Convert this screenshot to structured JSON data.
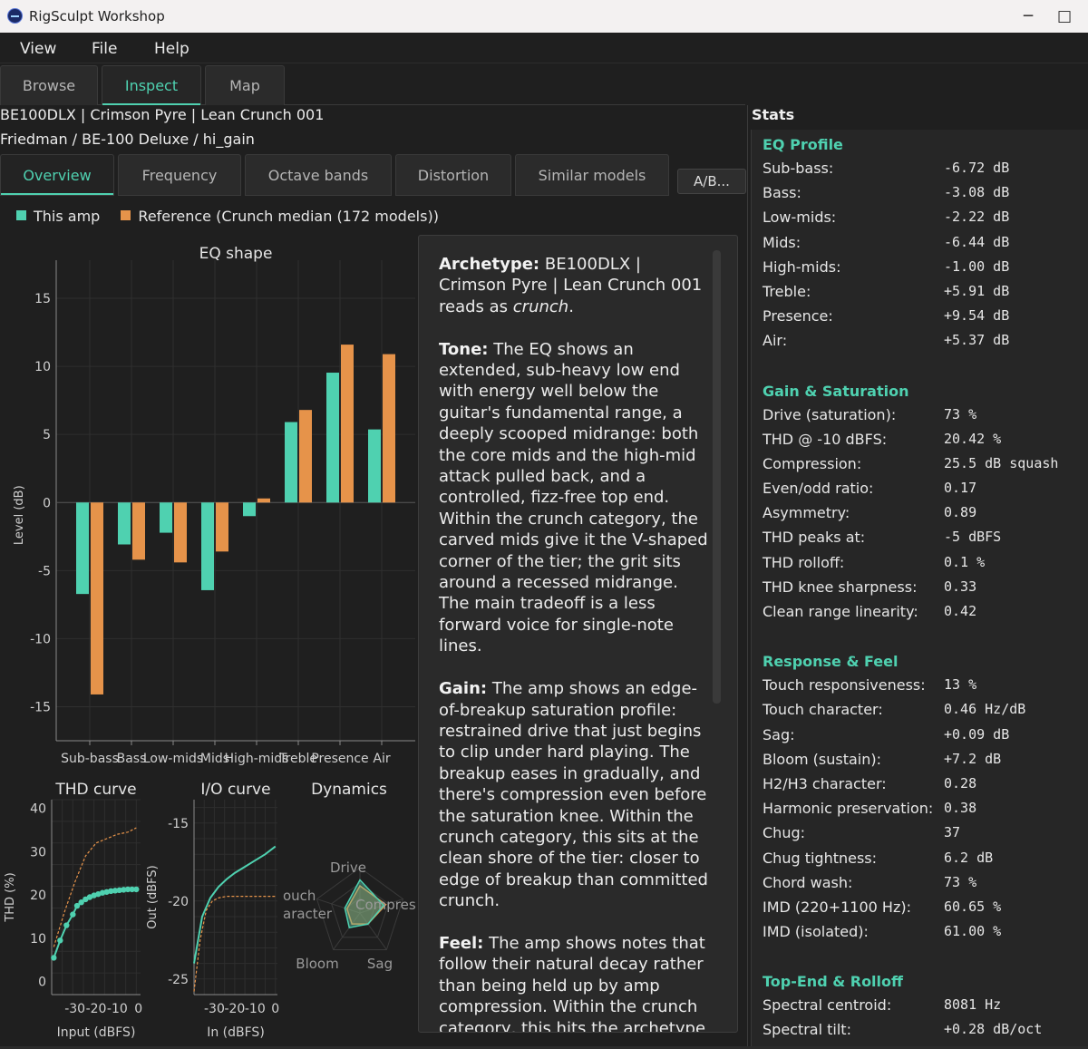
{
  "window": {
    "title": "RigSculpt Workshop",
    "minimize": "─",
    "maximize": "□"
  },
  "menu": [
    "View",
    "File",
    "Help"
  ],
  "main_tabs": [
    "Browse",
    "Inspect",
    "Map"
  ],
  "model": {
    "line1": "BE100DLX | Crimson Pyre | Lean Crunch 001",
    "line2": "Friedman / BE-100 Deluxe / hi_gain"
  },
  "sub_tabs": [
    "Overview",
    "Frequency",
    "Octave bands",
    "Distortion",
    "Similar models"
  ],
  "ab_button": "A/B...",
  "legend": {
    "this_amp": "This amp",
    "reference": "Reference (Crunch median (172 models))",
    "color_this": "#4fd1b0",
    "color_ref": "#e6934a"
  },
  "chart_data": [
    {
      "type": "bar",
      "title": "EQ shape",
      "xlabel": "",
      "ylabel": "Level (dB)",
      "categories": [
        "Sub-bass",
        "Bass",
        "Low-mids",
        "Mids",
        "High-mids",
        "Treble",
        "Presence",
        "Air"
      ],
      "series": [
        {
          "name": "This amp",
          "values": [
            -6.72,
            -3.08,
            -2.22,
            -6.44,
            -1.0,
            5.91,
            9.54,
            5.37
          ]
        },
        {
          "name": "Reference (Crunch median (172 models))",
          "values": [
            -14.1,
            -4.2,
            -4.4,
            -3.6,
            0.3,
            6.8,
            11.6,
            10.9
          ]
        }
      ],
      "ylim": [
        -17.5,
        17.8
      ],
      "yticks": [
        15,
        10,
        5,
        0,
        -5,
        -10,
        -15
      ]
    },
    {
      "type": "line",
      "title": "THD curve",
      "xlabel": "Input (dBFS)",
      "ylabel": "THD (%)",
      "xticks": [
        -30,
        -20,
        -10,
        0
      ],
      "yticks": [
        0,
        10,
        20,
        30,
        40
      ],
      "xlim": [
        -41,
        1
      ],
      "ylim": [
        -3,
        42
      ],
      "series": [
        {
          "name": "This amp",
          "x": [
            -40,
            -37,
            -34,
            -31,
            -29,
            -27,
            -25,
            -23,
            -21,
            -19,
            -17,
            -15,
            -13,
            -11,
            -9,
            -7,
            -5,
            -3,
            -1
          ],
          "y": [
            5.5,
            9.5,
            13,
            15.5,
            17.5,
            18.3,
            19,
            19.5,
            19.9,
            20.2,
            20.5,
            20.7,
            20.9,
            21.0,
            21.1,
            21.2,
            21.3,
            21.3,
            21.3
          ]
        },
        {
          "name": "Reference (Crunch median (172 models))",
          "x": [
            -40,
            -35,
            -30,
            -25,
            -20,
            -15,
            -10,
            -5,
            -1
          ],
          "y": [
            8,
            16,
            23,
            29,
            32,
            33,
            34,
            34.5,
            35.5
          ]
        }
      ]
    },
    {
      "type": "line",
      "title": "I/O curve",
      "xlabel": "In (dBFS)",
      "ylabel": "Out (dBFS)",
      "xticks": [
        -30,
        -20,
        -10,
        0
      ],
      "yticks": [
        -15,
        -20,
        -25
      ],
      "xlim": [
        -40,
        1
      ],
      "ylim": [
        -26,
        -13.5
      ],
      "series": [
        {
          "name": "This amp",
          "x": [
            -40,
            -36,
            -32,
            -28,
            -24,
            -20,
            -15,
            -10,
            -5,
            0
          ],
          "y": [
            -24,
            -21,
            -19.8,
            -19.1,
            -18.6,
            -18.2,
            -17.8,
            -17.4,
            -17.0,
            -16.5
          ]
        },
        {
          "name": "Reference (Crunch median (172 models))",
          "x": [
            -40,
            -37,
            -34,
            -31,
            -28,
            -24,
            -20,
            -10,
            0
          ],
          "y": [
            -25.8,
            -22.5,
            -20.6,
            -20.0,
            -19.8,
            -19.7,
            -19.7,
            -19.7,
            -19.7
          ]
        }
      ]
    },
    {
      "type": "radar",
      "title": "Dynamics",
      "axes": [
        "Drive",
        "Compression",
        "Sag",
        "Bloom",
        "Touch character"
      ],
      "axis_labels_visible": [
        "Drive",
        "Compres",
        "Sag",
        "Bloom",
        "ouch",
        "aracter"
      ],
      "series": [
        {
          "name": "This amp",
          "values": [
            0.73,
            0.55,
            0.3,
            0.4,
            0.35
          ]
        },
        {
          "name": "Reference (Crunch median (172 models))",
          "values": [
            0.6,
            0.6,
            0.3,
            0.3,
            0.3
          ]
        }
      ]
    }
  ],
  "summary": {
    "p1_label": "Archetype:",
    "p1_text": " BE100DLX | Crimson Pyre | Lean Crunch 001 reads as ",
    "p1_em": "crunch",
    "p1_end": ".",
    "p2_label": "Tone:",
    "p2_text": " The EQ shows an extended, sub-heavy low end with energy well below the guitar's fundamental range, a deeply scooped midrange: both the core mids and the high-mid attack pulled back, and a controlled, fizz-free top end. Within the crunch category, the carved mids give it the V-shaped corner of the tier; the grit sits around a recessed midrange. The main tradeoff is a less forward voice for single-note lines.",
    "p3_label": "Gain:",
    "p3_text": " The amp shows an edge-of-breakup saturation profile: restrained drive that just begins to clip under hard playing. The breakup eases in gradually, and there's compression even before the saturation knee. Within the crunch category, this sits at the clean shore of the tier: closer to edge of breakup than committed crunch.",
    "p4_label": "Feel:",
    "p4_text": " The amp shows notes that follow their natural decay rather than being held up by amp compression. Within the crunch category, this hits the archetype"
  },
  "stats": {
    "title": "Stats",
    "sections": [
      {
        "title": "EQ Profile",
        "rows": [
          [
            "Sub-bass:",
            "-6.72 dB"
          ],
          [
            "Bass:",
            "-3.08 dB"
          ],
          [
            "Low-mids:",
            "-2.22 dB"
          ],
          [
            "Mids:",
            "-6.44 dB"
          ],
          [
            "High-mids:",
            "-1.00 dB"
          ],
          [
            "Treble:",
            "+5.91 dB"
          ],
          [
            "Presence:",
            "+9.54 dB"
          ],
          [
            "Air:",
            "+5.37 dB"
          ]
        ]
      },
      {
        "title": "Gain & Saturation",
        "rows": [
          [
            "Drive (saturation):",
            "73 %"
          ],
          [
            "THD @ -10 dBFS:",
            "20.42 %"
          ],
          [
            "Compression:",
            "25.5 dB squash"
          ],
          [
            "Even/odd ratio:",
            "0.17"
          ],
          [
            "Asymmetry:",
            "0.89"
          ],
          [
            "THD peaks at:",
            "-5 dBFS"
          ],
          [
            "THD rolloff:",
            "0.1 %"
          ],
          [
            "THD knee sharpness:",
            "0.33"
          ],
          [
            "Clean range linearity:",
            "0.42"
          ]
        ]
      },
      {
        "title": "Response & Feel",
        "rows": [
          [
            "Touch responsiveness:",
            "13 %"
          ],
          [
            "Touch character:",
            "0.46 Hz/dB"
          ],
          [
            "Sag:",
            "+0.09 dB"
          ],
          [
            "Bloom (sustain):",
            "+7.2 dB"
          ],
          [
            "H2/H3 character:",
            "0.28"
          ],
          [
            "Harmonic preservation:",
            "0.38"
          ],
          [
            "Chug:",
            "37"
          ],
          [
            "Chug tightness:",
            "6.2 dB"
          ],
          [
            "Chord wash:",
            "73 %"
          ],
          [
            "IMD (220+1100 Hz):",
            "60.65 %"
          ],
          [
            "IMD (isolated):",
            "61.00 %"
          ]
        ]
      },
      {
        "title": "Top-End & Rolloff",
        "rows": [
          [
            "Spectral centroid:",
            "8081 Hz"
          ],
          [
            "Spectral tilt:",
            "+0.28 dB/oct"
          ]
        ]
      }
    ]
  }
}
